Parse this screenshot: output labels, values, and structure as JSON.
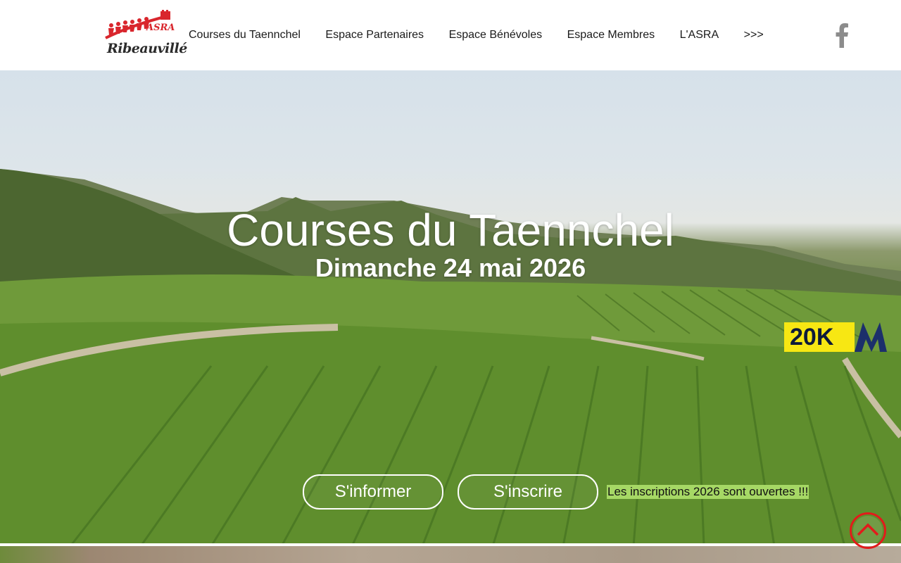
{
  "header": {
    "logo_text": "Ribeauvillé",
    "logo_subtext": "ASRA",
    "nav": [
      {
        "label": "Courses du Taennchel"
      },
      {
        "label": "Espace Partenaires"
      },
      {
        "label": "Espace Bénévoles"
      },
      {
        "label": "Espace Membres"
      },
      {
        "label": "L'ASRA"
      },
      {
        "label": ">>>"
      }
    ],
    "social_icon": "facebook-icon"
  },
  "hero": {
    "title": "Courses du Taennchel",
    "date": "Dimanche 24 mai 2026",
    "badge": "20K",
    "buttons": {
      "info_label": "S'informer",
      "signup_label": "S'inscrire"
    },
    "announcement": "Les inscriptions 2026 sont ouvertes !!!"
  },
  "colors": {
    "brand_red": "#d9262d",
    "announce_bg": "#a6d865",
    "badge_yellow": "#f7e713",
    "badge_navy": "#0d1a3a"
  },
  "icons": {
    "scroll_top": "chevron-up-circle-icon",
    "facebook": "facebook-icon"
  }
}
